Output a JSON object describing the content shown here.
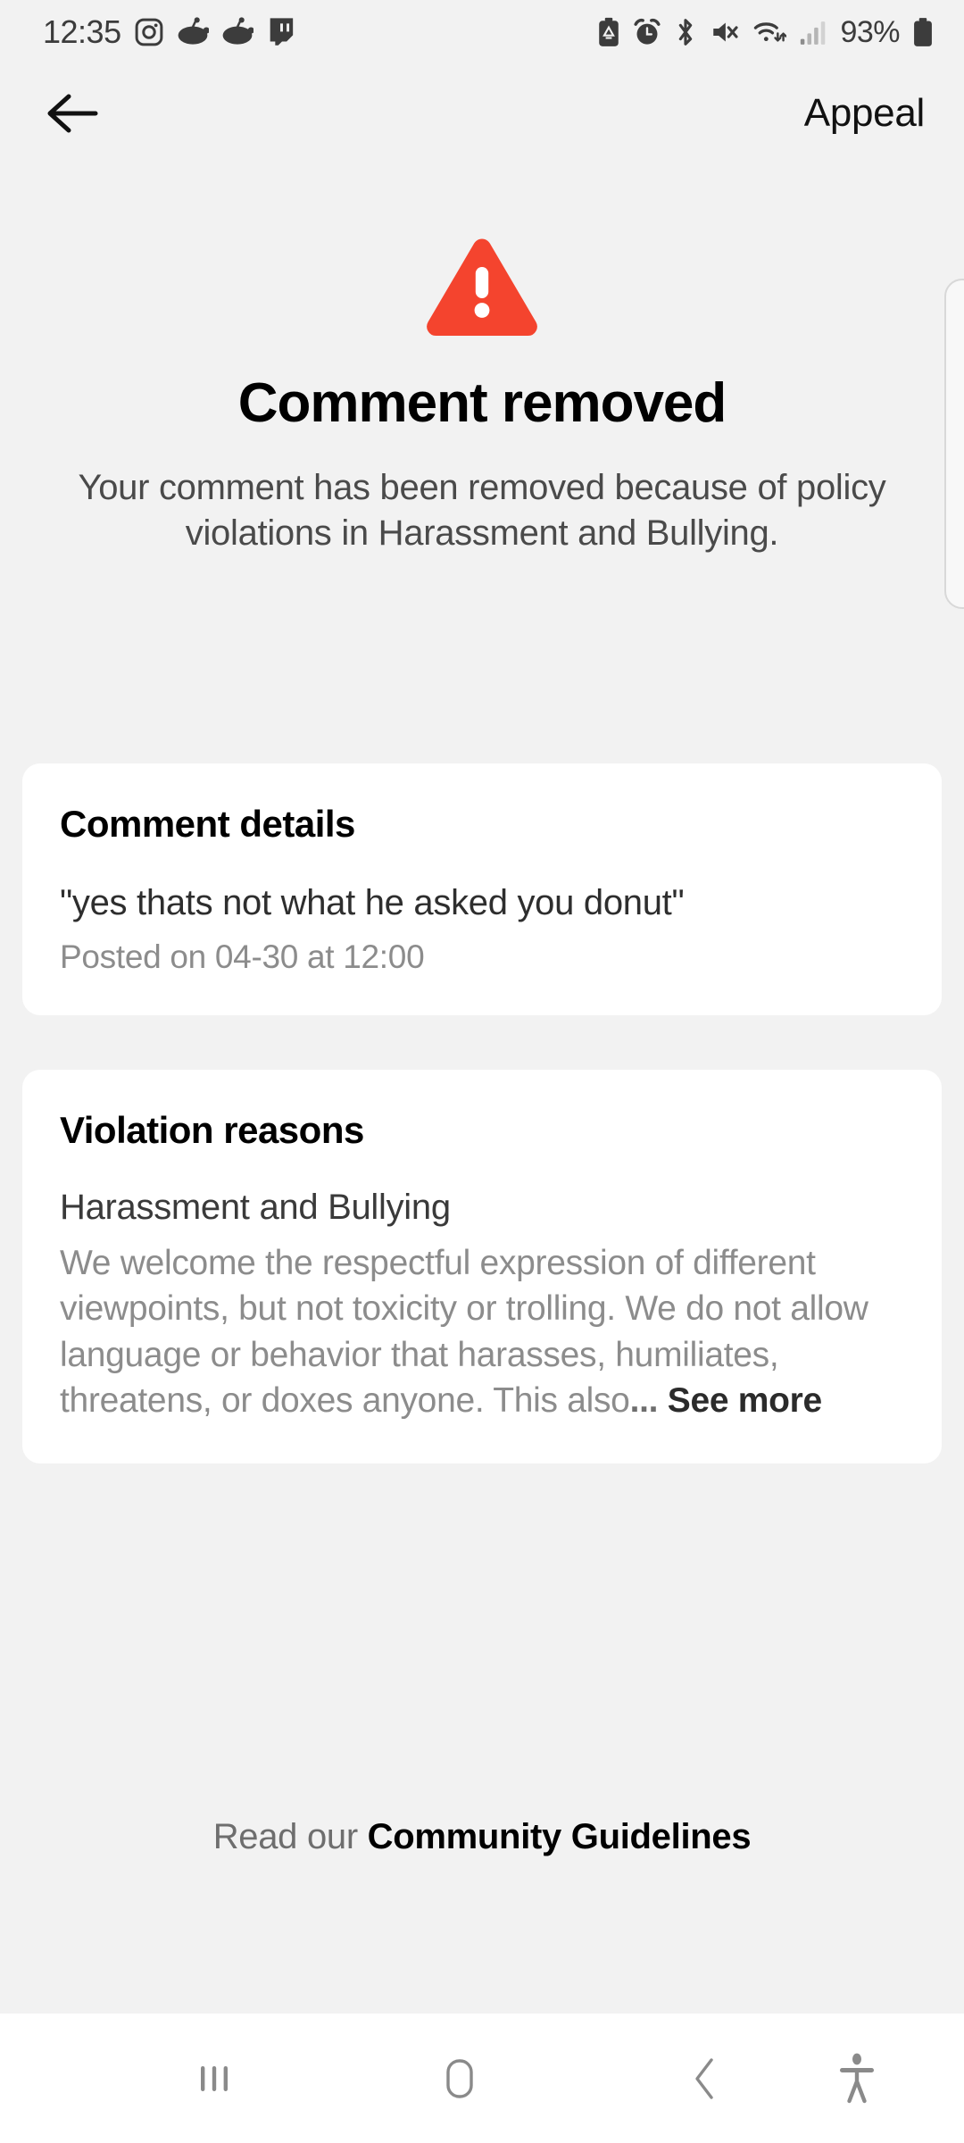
{
  "status_bar": {
    "time": "12:35",
    "battery_percent": "93%",
    "app_icons": [
      "instagram-icon",
      "reddit-icon",
      "reddit-icon",
      "twitch-icon"
    ],
    "system_icons": [
      "battery-saver-icon",
      "alarm-icon",
      "bluetooth-icon",
      "volume-mute-icon",
      "wifi-icon",
      "cellular-signal-icon",
      "battery-icon"
    ]
  },
  "header": {
    "back_icon": "arrow-left-icon",
    "title": "Appeal"
  },
  "hero": {
    "icon": "warning-triangle-icon",
    "icon_color": "#F4442E",
    "title": "Comment removed",
    "subtitle": "Your comment has been removed because of policy violations in Harassment and Bullying."
  },
  "comment_card": {
    "title": "Comment details",
    "quote": "\"yes thats not what he asked you donut\"",
    "meta": "Posted on 04-30 at 12:00"
  },
  "violation_card": {
    "title": "Violation reasons",
    "reason_name": "Harassment and Bullying",
    "reason_body": "We welcome the respectful expression of different viewpoints, but not toxicity or trolling. We do not allow language or behavior that harasses, humiliates, threatens, or doxes anyone. This also",
    "ellipsis": "...",
    "see_more_label": "See more"
  },
  "footer": {
    "prefix": "Read our ",
    "link_label": "Community Guidelines"
  },
  "nav_bar": {
    "recents_icon": "recents-icon",
    "home_icon": "home-icon",
    "back_icon": "back-chevron-icon",
    "accessibility_icon": "accessibility-icon"
  },
  "theme": {
    "background": "#F2F2F2",
    "card_background": "#FFFFFF",
    "accent": "#F4442E",
    "text_primary": "#000000",
    "text_secondary": "#8C8C8C"
  }
}
